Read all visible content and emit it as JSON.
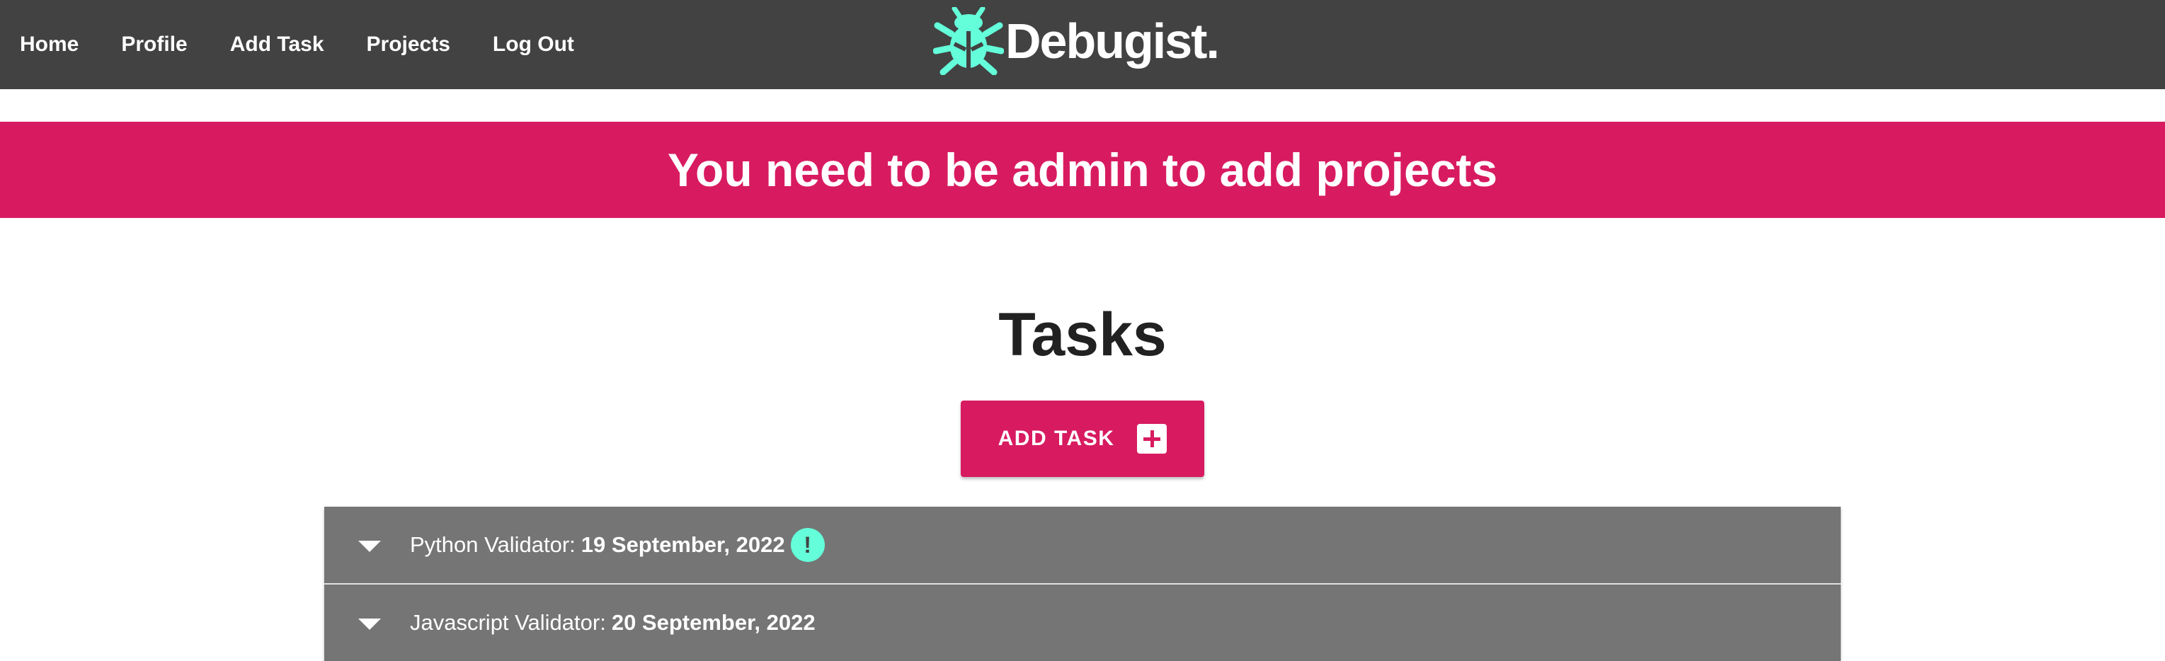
{
  "nav": {
    "links": [
      "Home",
      "Profile",
      "Add Task",
      "Projects",
      "Log Out"
    ],
    "brand": "Debugist.",
    "brand_icon": "bug-icon"
  },
  "alert": {
    "message": "You need to be admin to add projects"
  },
  "main": {
    "title": "Tasks",
    "add_task_label": "ADD TASK",
    "add_task_icon": "plus-icon"
  },
  "tasks": [
    {
      "project": "Python Validator:",
      "date": "19 September, 2022",
      "has_alert": true,
      "alert_symbol": "!"
    },
    {
      "project": "Javascript Validator:",
      "date": "20 September, 2022",
      "has_alert": false
    }
  ],
  "colors": {
    "navbar": "#424242",
    "accent": "#d81b60",
    "mint": "#64ffda",
    "list_item": "#757575"
  }
}
